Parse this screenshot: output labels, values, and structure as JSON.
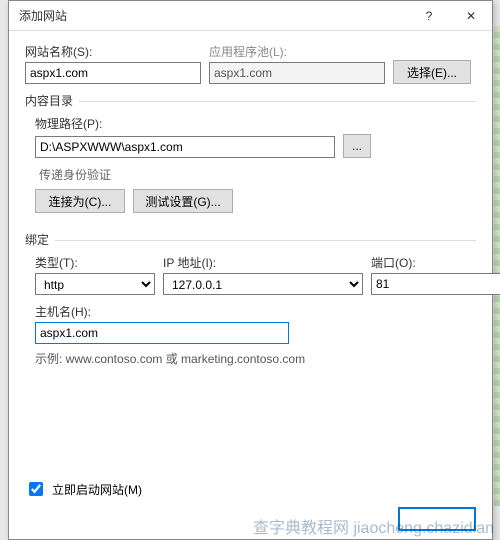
{
  "title": "添加网站",
  "help_icon": "?",
  "close_icon": "✕",
  "siteName": {
    "label": "网站名称(S):",
    "value": "aspx1.com"
  },
  "appPool": {
    "label": "应用程序池(L):",
    "value": "aspx1.com"
  },
  "selectBtn": "选择(E)...",
  "contentDir": {
    "groupLabel": "内容目录",
    "pathLabel": "物理路径(P):",
    "pathValue": "D:\\ASPXWWW\\aspx1.com",
    "browse": "...",
    "authLabel": "传递身份验证",
    "connectAs": "连接为(C)...",
    "testSettings": "测试设置(G)..."
  },
  "binding": {
    "groupLabel": "绑定",
    "typeLabel": "类型(T):",
    "typeValue": "http",
    "ipLabel": "IP 地址(I):",
    "ipValue": "127.0.0.1",
    "portLabel": "端口(O):",
    "portValue": "81",
    "hostLabel": "主机名(H):",
    "hostValue": "aspx1.com",
    "example": "示例: www.contoso.com 或 marketing.contoso.com"
  },
  "startNow": {
    "checked": true,
    "label": "立即启动网站(M)"
  },
  "watermark": "查字典教程网 jiaocheng.chazidian"
}
